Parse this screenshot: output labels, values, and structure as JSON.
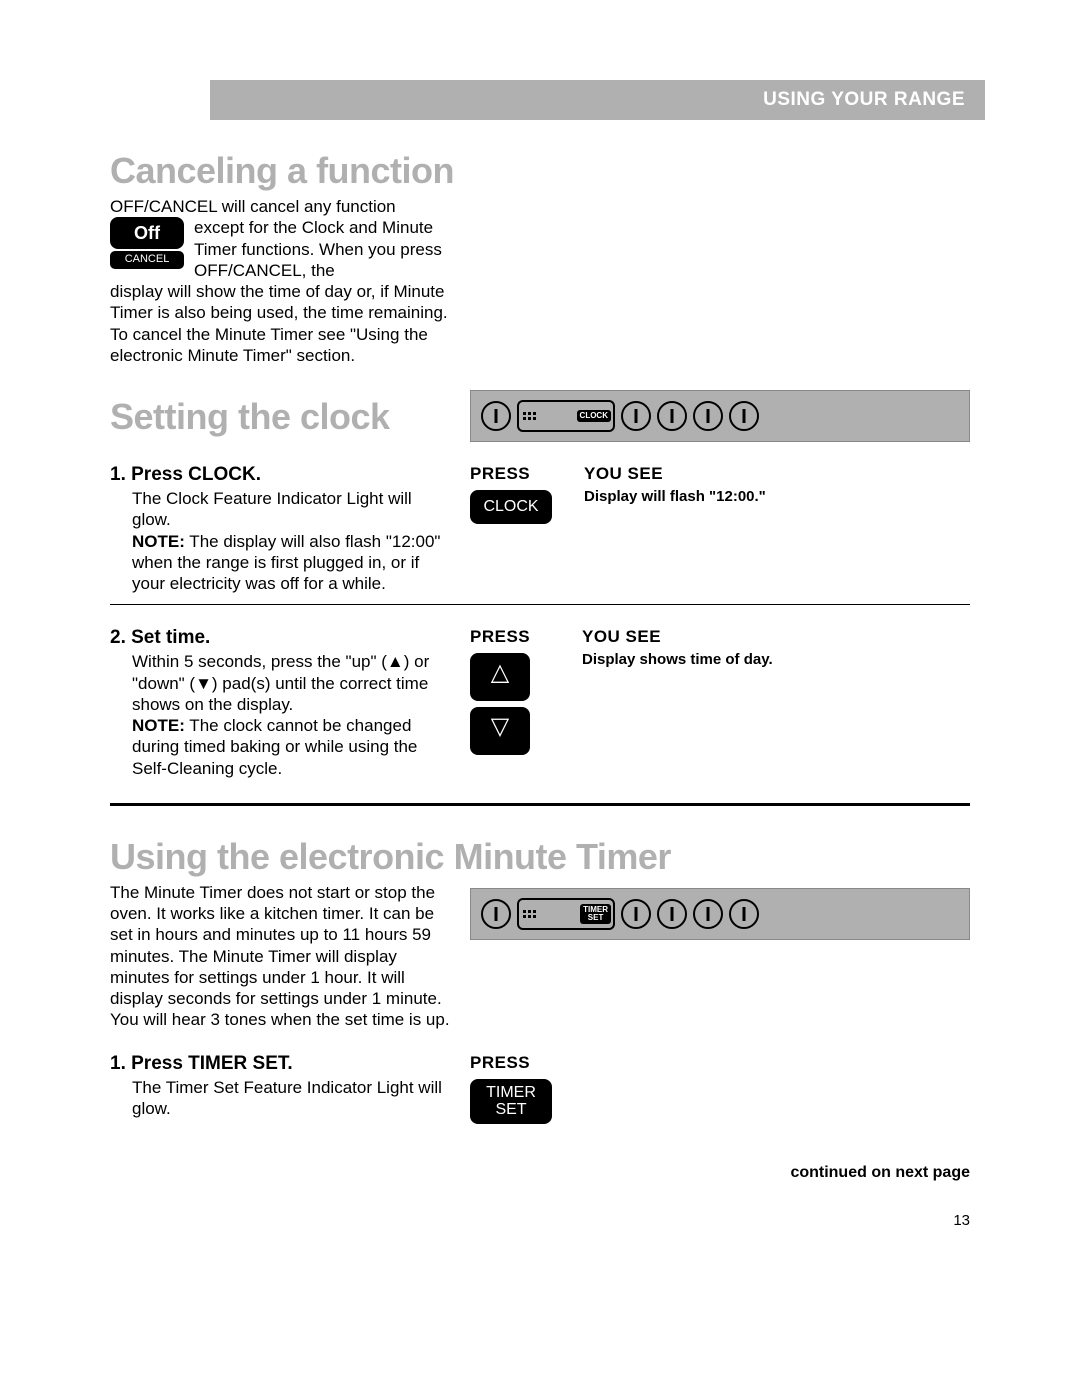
{
  "header": "USING YOUR RANGE",
  "cancel": {
    "heading": "Canceling a function",
    "intro": "OFF/CANCEL will cancel any function",
    "btn_off": "Off",
    "btn_cancel": "CANCEL",
    "wrap_text": "except for the Clock and Minute Timer functions. When you press OFF/CANCEL, the",
    "after": "display will show the time of day or, if Minute Timer is also being used, the time remaining. To cancel the Minute Timer see \"Using the electronic Minute Timer\" section."
  },
  "clock": {
    "heading": "Setting the clock",
    "panel_label": "CLOCK",
    "step1_title": "1. Press CLOCK.",
    "step1_desc": "The Clock Feature Indicator Light will glow.",
    "step1_note_label": "NOTE:",
    "step1_note": " The display will also flash \"12:00\" when the range is first plugged in, or if your electricity was off for a while.",
    "step1_press_head": "PRESS",
    "step1_yousee_head": "YOU SEE",
    "step1_yousee_text": "Display will flash \"12:00.\"",
    "step1_btn": "CLOCK",
    "step2_title": "2. Set time.",
    "step2_desc": "Within 5 seconds, press the \"up\" (▲) or \"down\" (▼) pad(s) until the correct time shows on the display.",
    "step2_note_label": "NOTE:",
    "step2_note": " The clock cannot be changed during timed baking or while using the Self-Cleaning cycle.",
    "step2_press_head": "PRESS",
    "step2_yousee_head": "YOU SEE",
    "step2_yousee_text": "Display shows time of day.",
    "step2_up": "△",
    "step2_down": "▽"
  },
  "timer": {
    "heading": "Using the electronic Minute Timer",
    "intro": "The Minute Timer does not start or stop the oven. It works like a kitchen timer. It can be set in hours and minutes up to 11 hours 59 minutes. The Minute Timer will display minutes for settings under 1 hour. It will display seconds for settings under 1 minute. You will hear 3 tones when the set time is up.",
    "panel_label_1": "TIMER",
    "panel_label_2": "SET",
    "step1_title": "1. Press TIMER SET.",
    "step1_desc": "The Timer Set Feature Indicator Light will glow.",
    "step1_press_head": "PRESS",
    "step1_btn_1": "TIMER",
    "step1_btn_2": "SET"
  },
  "continued": "continued on next page",
  "pagenum": "13"
}
